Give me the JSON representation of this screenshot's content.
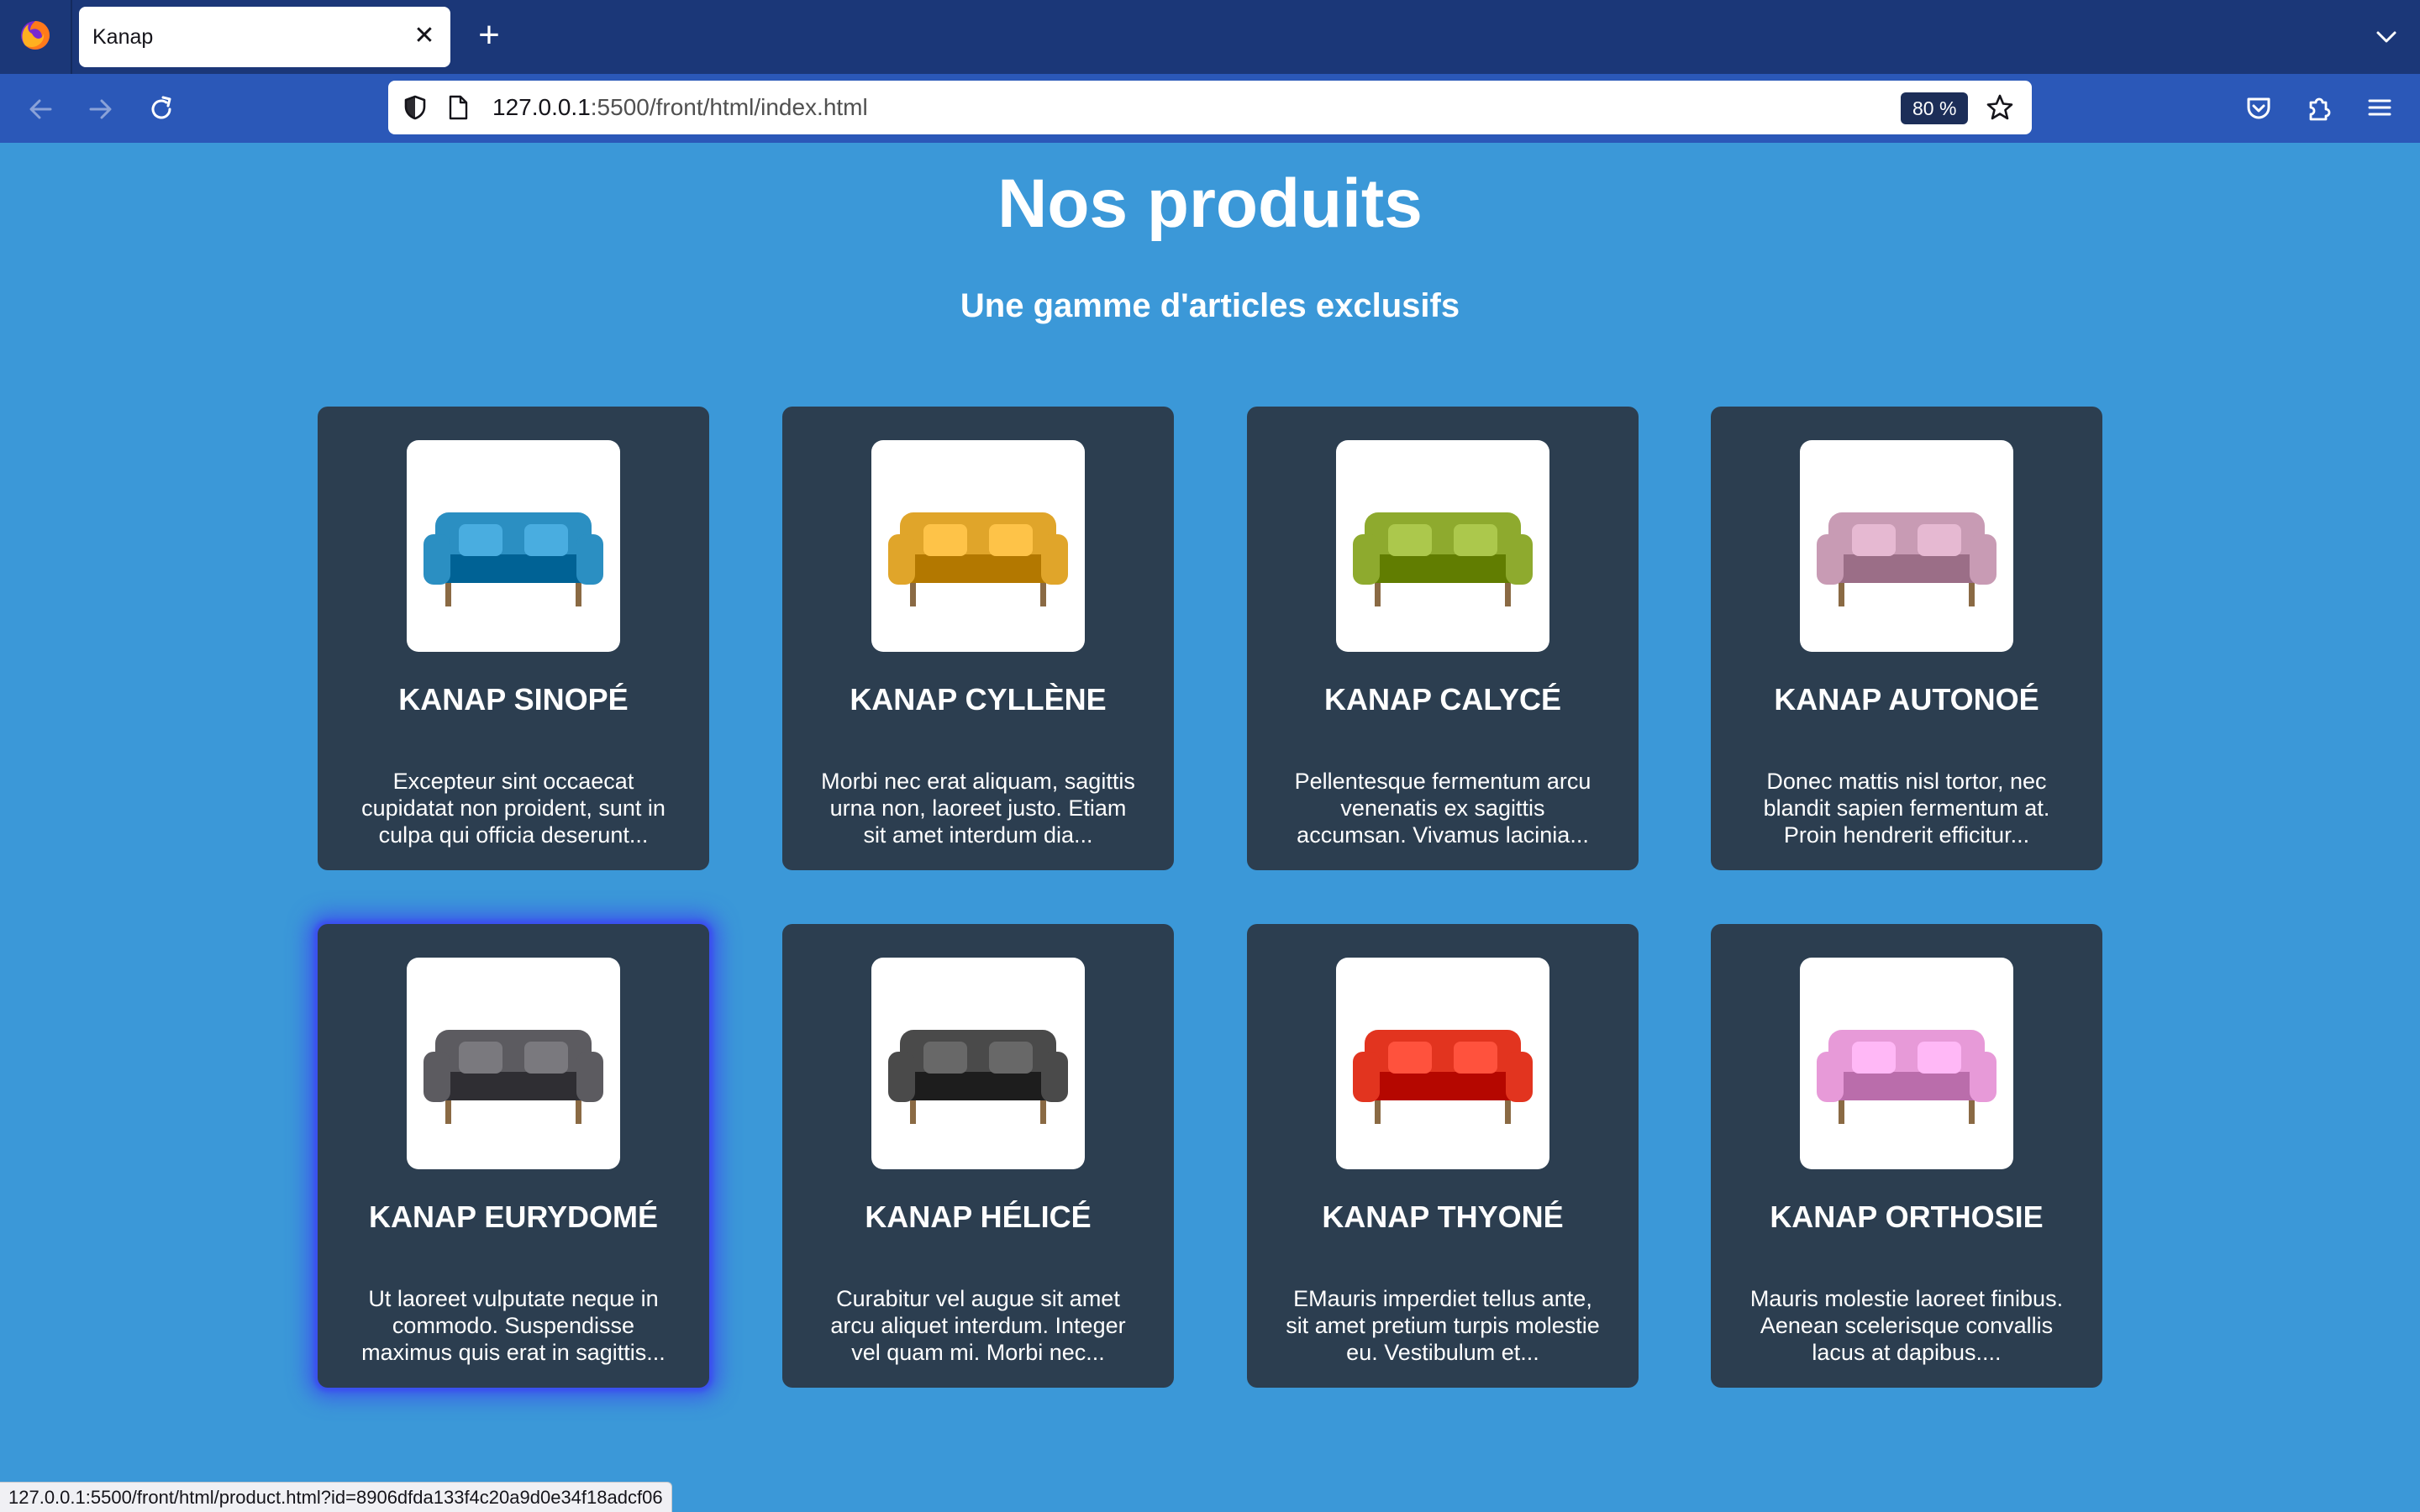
{
  "browser": {
    "tab_title": "Kanap",
    "url_host": "127.0.0.1",
    "url_rest": ":5500/front/html/index.html",
    "zoom": "80 %",
    "status_url": "127.0.0.1:5500/front/html/product.html?id=8906dfda133f4c20a9d0e34f18adcf06"
  },
  "page": {
    "title": "Nos produits",
    "subtitle": "Une gamme d'articles exclusifs"
  },
  "products": [
    {
      "name": "KANAP SINOPÉ",
      "desc": "Excepteur sint occaecat cupidatat non proident, sunt in culpa qui officia deserunt...",
      "color": "#2b8fc2"
    },
    {
      "name": "KANAP CYLLÈNE",
      "desc": "Morbi nec erat aliquam, sagittis urna non, laoreet justo. Etiam sit amet interdum dia...",
      "color": "#e0a52a"
    },
    {
      "name": "KANAP CALYCÉ",
      "desc": "Pellentesque fermentum arcu venenatis ex sagittis accumsan. Vivamus lacinia...",
      "color": "#8eaa2e"
    },
    {
      "name": "KANAP AUTONOÉ",
      "desc": "Donec mattis nisl tortor, nec blandit sapien fermentum at. Proin hendrerit efficitur...",
      "color": "#c89bb4"
    },
    {
      "name": "KANAP EURYDOMÉ",
      "desc": "Ut laoreet vulputate neque in commodo. Suspendisse maximus quis erat in sagittis...",
      "color": "#5c5b60"
    },
    {
      "name": "KANAP HÉLICÉ",
      "desc": "Curabitur vel augue sit amet arcu aliquet interdum. Integer vel quam mi. Morbi nec...",
      "color": "#4a4a4a"
    },
    {
      "name": "KANAP THYONÉ",
      "desc": "EMauris imperdiet tellus ante, sit amet pretium turpis molestie eu. Vestibulum et...",
      "color": "#e2341f"
    },
    {
      "name": "KANAP ORTHOSIE",
      "desc": "Mauris molestie laoreet finibus. Aenean scelerisque convallis lacus at dapibus....",
      "color": "#e79ad8"
    }
  ]
}
